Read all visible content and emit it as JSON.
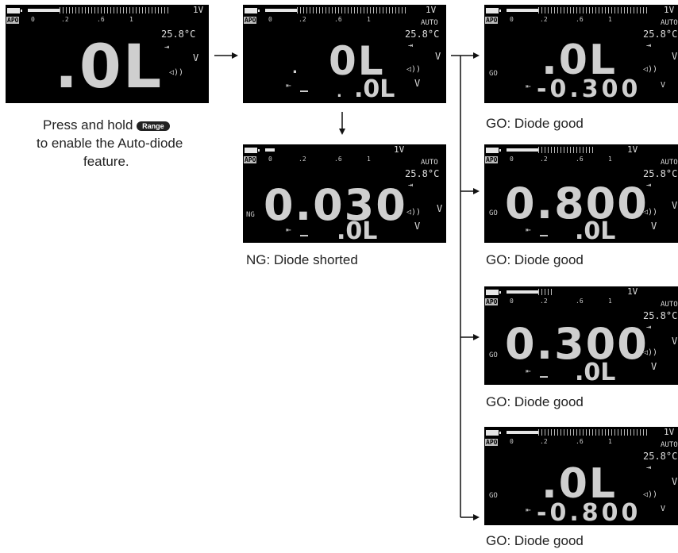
{
  "common": {
    "range_v": "1V",
    "scale_0": "0",
    "scale_2": ".2",
    "scale_6": ".6",
    "scale_1": "1",
    "apo": "APO",
    "auto": "AUTO",
    "temp": "25.8°C",
    "unit_v": "V",
    "diode_sym": "⇥",
    "sound_sym": "◁))",
    "diode_small": "⇤"
  },
  "panels": {
    "p1": {
      "main": ".0L"
    },
    "p2": {
      "main": "0L",
      "sub_main": ".0L",
      "dash": "_",
      "dot": ".",
      "dot2": "."
    },
    "p3": {
      "main": "0.030",
      "sub_main": ".0L",
      "dash": "_",
      "tag": "NG"
    },
    "p4": {
      "main": ".0L",
      "sub_main": "-0.300",
      "tag": "GO"
    },
    "p5": {
      "main": "0.800",
      "sub_main": ".0L",
      "dash": "_",
      "tag": "GO"
    },
    "p6": {
      "main": "0.300",
      "sub_main": ".0L",
      "dash": "_",
      "tag": "GO"
    },
    "p7": {
      "main": ".0L",
      "sub_main": "-0.800",
      "tag": "GO"
    }
  },
  "captions": {
    "press_line1": "Press and hold",
    "range_button": "Range",
    "press_line2": "to enable the Auto-diode",
    "press_line3": "feature.",
    "ng": "NG: Diode shorted",
    "go1": "GO: Diode good",
    "go2": "GO: Diode good",
    "go3": "GO: Diode good",
    "go4": "GO: Diode good"
  }
}
